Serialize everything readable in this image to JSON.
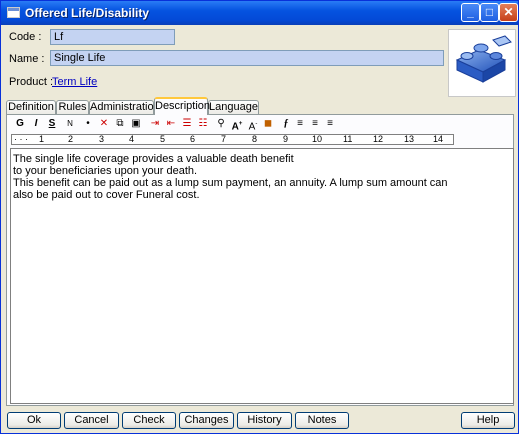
{
  "window": {
    "title": "Offered Life/Disability"
  },
  "form": {
    "code_label": "Code :",
    "code_value": "Lf",
    "name_label": "Name :",
    "name_value": "Single Life",
    "product_label": "Product :",
    "product_link": "Term Life"
  },
  "tabs": [
    "Definition",
    "Rules",
    "Administration",
    "Description",
    "Language"
  ],
  "active_tab": "Description",
  "toolbar": {
    "bold": "G",
    "italic": "I",
    "underline": "S",
    "normal": "N",
    "icons": [
      "bullet-icon",
      "cut-icon",
      "copy-icon",
      "paste-icon",
      "indent-icon",
      "outdent-icon",
      "list-icon",
      "list2-icon",
      "find-icon",
      "grow-font-icon",
      "shrink-font-icon",
      "color-icon",
      "font-icon",
      "align-left-icon",
      "align-center-icon",
      "align-right-icon"
    ]
  },
  "ruler": [
    "1",
    "2",
    "3",
    "4",
    "5",
    "6",
    "7",
    "8",
    "9",
    "10",
    "11",
    "12",
    "13",
    "14"
  ],
  "description": {
    "lines": [
      "The single life coverage provides a valuable death benefit",
      "to your beneficiaries upon your death.",
      "",
      "This benefit can be paid out as a lump sum payment, an annuity. A lump sum amount can",
      "also be paid out to cover Funeral cost."
    ]
  },
  "buttons": {
    "ok": "Ok",
    "cancel": "Cancel",
    "check": "Check",
    "changes": "Changes",
    "history": "History",
    "notes": "Notes",
    "help": "Help"
  },
  "colors": {
    "field_bg": "#c4d3f2",
    "titlebar": "#0553e0",
    "tab_highlight": "#ffc83c",
    "link": "#0000c0"
  }
}
